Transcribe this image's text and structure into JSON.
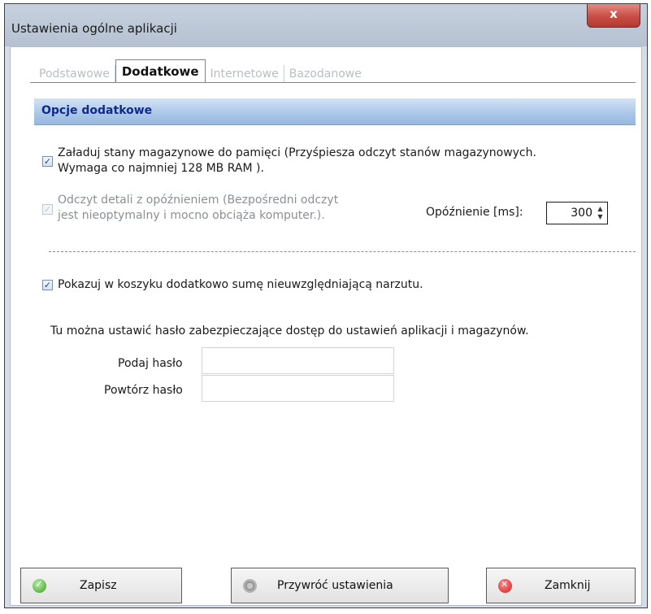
{
  "window": {
    "title": "Ustawienia ogólne aplikacji",
    "close_label": "x"
  },
  "tabs": [
    {
      "label": "Podstawowe",
      "active": false
    },
    {
      "label": "Dodatkowe",
      "active": true
    },
    {
      "label": "Internetowe",
      "active": false
    },
    {
      "label": "Bazodanowe",
      "active": false
    }
  ],
  "section": {
    "title": "Opcje dodatkowe"
  },
  "options": {
    "load_stock": {
      "checked": true,
      "line1": "Załaduj stany magazynowe do pamięci  (Przyśpiesza odczyt stanów magazynowych.",
      "line2": "Wymaga co najmniej 128 MB RAM )."
    },
    "delayed_details": {
      "checked": true,
      "disabled": true,
      "line1": "Odczyt detali z opóźnieniem  (Bezpośredni odczyt",
      "line2": "jest nieoptymalny i mocno obciąża komputer.).",
      "delay_label": "Opóźnienie [ms]:",
      "delay_value": "300"
    },
    "cart_sum": {
      "checked": true,
      "label": "Pokazuj w koszyku dodatkowo sumę nieuwzględniającą narzutu."
    }
  },
  "password": {
    "info": "Tu można ustawić hasło zabezpieczające dostęp do ustawień aplikacji i magazynów.",
    "enter_label": "Podaj hasło",
    "repeat_label": "Powtórz hasło",
    "enter_value": "",
    "repeat_value": ""
  },
  "buttons": {
    "save": "Zapisz",
    "restore": "Przywróć ustawienia",
    "close": "Zamknij"
  },
  "icons": {
    "save": "check-circle-icon",
    "restore": "gear-icon",
    "close": "x-circle-icon"
  }
}
